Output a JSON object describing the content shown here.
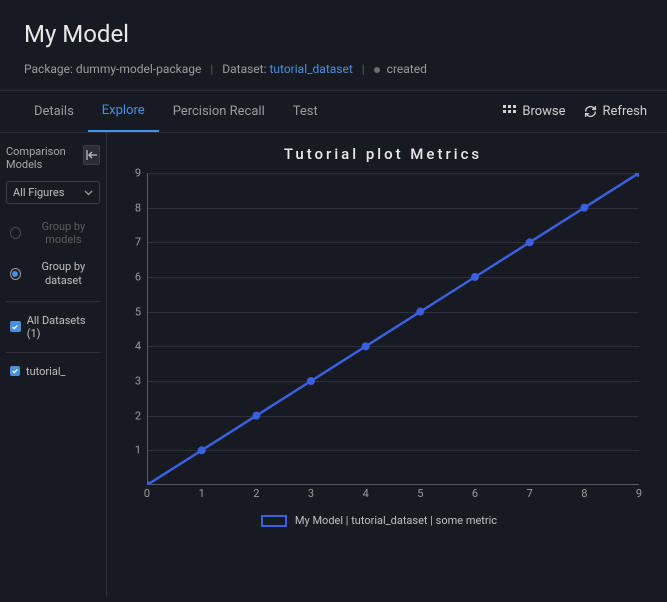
{
  "header": {
    "title": "My Model",
    "package_label": "Package:",
    "package_value": "dummy-model-package",
    "dataset_label": "Dataset:",
    "dataset_value": "tutorial_dataset",
    "status": "created"
  },
  "tabs": {
    "items": [
      "Details",
      "Explore",
      "Percision Recall",
      "Test"
    ],
    "active_index": 1
  },
  "actions": {
    "browse": "Browse",
    "refresh": "Refresh"
  },
  "sidebar": {
    "comparison_label": "Comparison Models",
    "figures_select": "All Figures",
    "group_by_models": "Group by models",
    "group_by_dataset": "Group by dataset",
    "all_datasets": "All Datasets (1)",
    "dataset_item": "tutorial_"
  },
  "chart_data": {
    "type": "line",
    "title": "Tutorial plot Metrics",
    "x": [
      0,
      1,
      2,
      3,
      4,
      5,
      6,
      7,
      8,
      9
    ],
    "y": [
      0,
      1,
      2,
      3,
      4,
      5,
      6,
      7,
      8,
      9
    ],
    "xlim": [
      0,
      9
    ],
    "ylim": [
      0,
      9
    ],
    "xticks": [
      0,
      1,
      2,
      3,
      4,
      5,
      6,
      7,
      8,
      9
    ],
    "yticks": [
      1,
      2,
      3,
      4,
      5,
      6,
      7,
      8,
      9
    ],
    "series_name": "My Model | tutorial_dataset | some metric",
    "color": "#3a5fe0"
  }
}
